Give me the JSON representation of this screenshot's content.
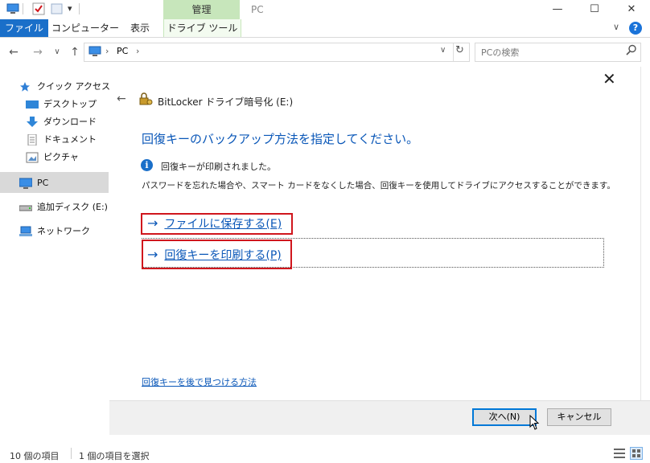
{
  "window": {
    "title": "PC",
    "context_tab_header": "管理",
    "minimize": "—",
    "maximize": "☐",
    "close": "✕"
  },
  "ribbon": {
    "tabs": [
      "ファイル",
      "コンピューター",
      "表示",
      "ドライブ ツール"
    ],
    "help": "?",
    "collapse": "∨"
  },
  "address": {
    "path": [
      "PC"
    ],
    "separator": "›",
    "search_placeholder": "PCの検索"
  },
  "sidebar": {
    "items": [
      {
        "label": "クイック アクセス",
        "icon": "star-icon"
      },
      {
        "label": "デスクトップ",
        "icon": "desktop-icon"
      },
      {
        "label": "ダウンロード",
        "icon": "download-icon"
      },
      {
        "label": "ドキュメント",
        "icon": "document-icon"
      },
      {
        "label": "ピクチャ",
        "icon": "pictures-icon"
      },
      {
        "label": "PC",
        "icon": "pc-icon"
      },
      {
        "label": "追加ディスク (E:)",
        "icon": "drive-icon"
      },
      {
        "label": "ネットワーク",
        "icon": "network-icon"
      }
    ]
  },
  "wizard": {
    "title": "BitLocker ドライブ暗号化 (E:)",
    "heading": "回復キーのバックアップ方法を指定してください。",
    "info": "回復キーが印刷されました。",
    "description": "パスワードを忘れた場合や、スマート カードをなくした場合、回復キーを使用してドライブにアクセスすることができます。",
    "options": [
      {
        "label": "ファイルに保存する",
        "accel": "(E)"
      },
      {
        "label": "回復キーを印刷する",
        "accel": "(P)"
      }
    ],
    "link": "回復キーを後で見つける方法",
    "next_button": "次へ(N)",
    "cancel_button": "キャンセル"
  },
  "status": {
    "items": "10 個の項目",
    "selected": "1 個の項目を選択"
  },
  "colors": {
    "accent": "#1a6fc9",
    "link": "#0a57b8",
    "highlight": "#d0161d",
    "context_tab": "#c7e6bb"
  }
}
